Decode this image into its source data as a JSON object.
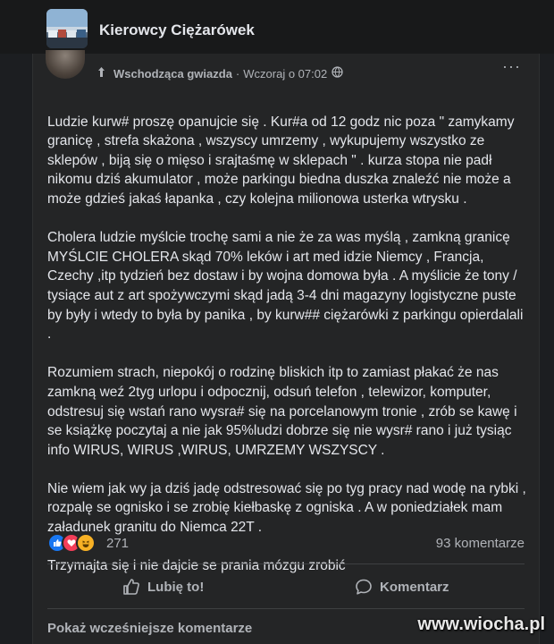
{
  "group": {
    "name": "Kierowcy Ciężarówek"
  },
  "post": {
    "author_badge": "Wschodząca gwiazda",
    "separator": "·",
    "timestamp": "Wczoraj o 07:02",
    "paragraphs": [
      "Ludzie kurw# proszę opanujcie się . Kur#a od 12 godz nic poza \" zamykamy granicę , strefa skażona , wszyscy umrzemy , wykupujemy wszystko ze sklepów , biją się o mięso i srajtaśmę  w sklepach  \" .  kurza stopa nie padł nikomu dziś akumulator , może  parkingu biedna duszka znaleźć nie może a może gdzieś jakaś łapanka , czy kolejna milionowa usterka wtrysku  .",
      " Cholera ludzie myślcie trochę sami a nie że za was myślą , zamkną granicę MYŚLCIE CHOLERA skąd 70% leków i art med idzie Niemcy , Francja, Czechy ,itp tydzień bez dostaw i by wojna domowa była . A myślicie że tony / tysiące aut z art spożywczymi skąd jadą 3-4 dni magazyny logistyczne puste by były i wtedy to była by panika , by kurw## ciężarówki z parkingu opierdalali .",
      "Rozumiem strach, niepokój o rodzinę bliskich itp to zamiast płakać że nas zamkną weź 2tyg urlopu i odpocznij, odsuń telefon , telewizor, komputer, odstresuj się wstań rano wysra# się na porcelanowym tronie , zrób se kawę i se książkę poczytaj a nie jak 95%ludzi dobrze się nie wysr# rano i już tysiąc info WIRUS, WIRUS ,WIRUS, UMRZEMY WSZYSCY .",
      "Nie wiem jak wy ja dziś jadę odstresować się po tyg pracy nad wodę na rybki , rozpalę se ognisko i se zrobię kiełbaskę z ogniska . A w poniedziałek mam załadunek granitu do Niemca 22T  .",
      "Trzymajta się i nie dajcie se prania mózgu zrobić"
    ],
    "reactions_count": "271",
    "comments_count": "93 komentarze",
    "reaction_icons": [
      "like-icon",
      "love-icon",
      "haha-icon"
    ]
  },
  "actions": {
    "like_label": "Lubię to!",
    "comment_label": "Komentarz"
  },
  "comments": {
    "show_previous_label": "Pokaż wcześniejsze komentarze"
  },
  "watermark": "www.wiocha.pl",
  "colors": {
    "background": "#1c1e21",
    "card": "#242526",
    "text": "#e4e6eb",
    "secondary_text": "#b0b3b8",
    "like_blue": "#1877f2",
    "love_red": "#f33e58",
    "haha_yellow": "#f7b125"
  }
}
